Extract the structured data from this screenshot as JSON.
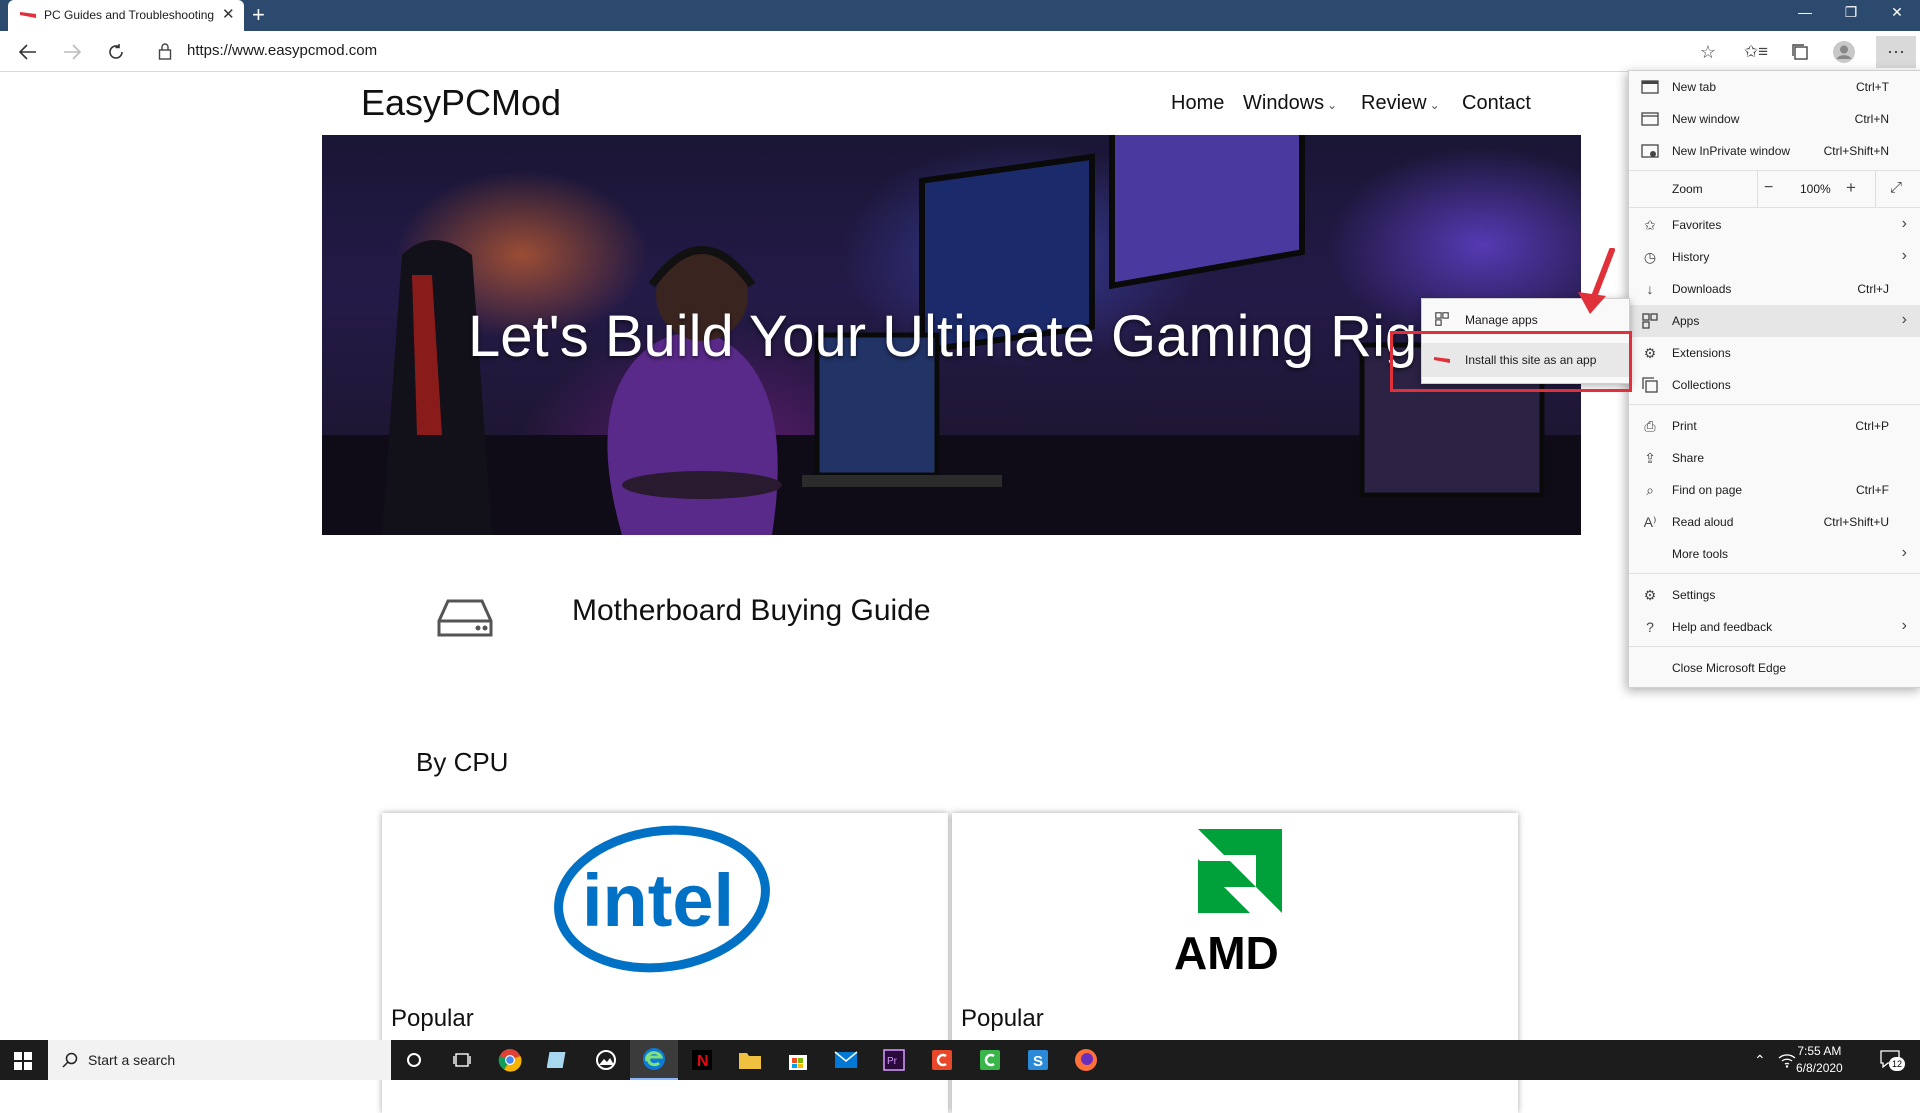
{
  "browser": {
    "tab_title": "PC Guides and Troubleshooting",
    "url": "https://www.easypcmod.com"
  },
  "page": {
    "site_title": "EasyPCMod",
    "nav": [
      "Home",
      "Windows",
      "Review",
      "Contact"
    ],
    "hero_caption": "Let's Build Your Ultimate Gaming Rig",
    "guide_title": "Motherboard Buying Guide",
    "by_cpu": "By CPU",
    "cards": [
      {
        "logo": "intel",
        "label": "Popular"
      },
      {
        "logo": "AMD",
        "label": "Popular"
      }
    ]
  },
  "menu": {
    "new_tab": "New tab",
    "new_tab_sc": "Ctrl+T",
    "new_window": "New window",
    "new_window_sc": "Ctrl+N",
    "new_inprivate": "New InPrivate window",
    "new_inprivate_sc": "Ctrl+Shift+N",
    "zoom": "Zoom",
    "zoom_value": "100%",
    "favorites": "Favorites",
    "history": "History",
    "downloads": "Downloads",
    "downloads_sc": "Ctrl+J",
    "apps": "Apps",
    "extensions": "Extensions",
    "collections": "Collections",
    "print": "Print",
    "print_sc": "Ctrl+P",
    "share": "Share",
    "find": "Find on page",
    "find_sc": "Ctrl+F",
    "read_aloud": "Read aloud",
    "read_aloud_sc": "Ctrl+Shift+U",
    "more_tools": "More tools",
    "settings": "Settings",
    "help": "Help and feedback",
    "close": "Close Microsoft Edge"
  },
  "submenu": {
    "manage_apps": "Manage apps",
    "install_app": "Install this site as an app"
  },
  "taskbar": {
    "search_placeholder": "Start a search",
    "time": "7:55 AM",
    "date": "6/8/2020",
    "notification_count": "12"
  },
  "colors": {
    "titlebar": "#2b4a6e",
    "highlight": "#e0303a",
    "intel_blue": "#0071c5",
    "amd_green": "#00a13b"
  }
}
